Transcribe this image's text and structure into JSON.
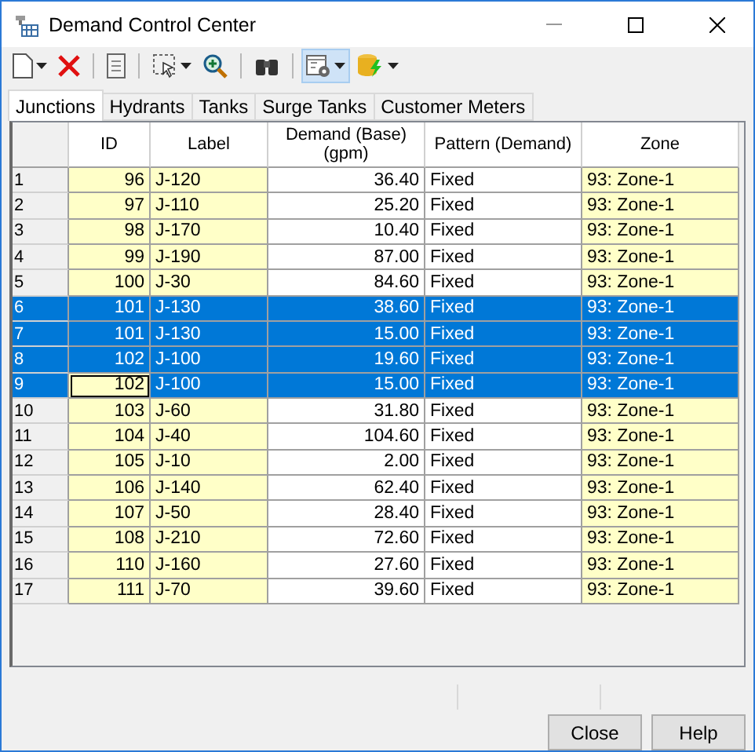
{
  "window": {
    "title": "Demand Control Center"
  },
  "toolbar": [
    {
      "kind": "new",
      "dropdown": true,
      "highlighted": false
    },
    {
      "kind": "delete",
      "dropdown": false,
      "highlighted": false
    },
    {
      "kind": "separator"
    },
    {
      "kind": "report",
      "dropdown": false,
      "highlighted": false
    },
    {
      "kind": "separator"
    },
    {
      "kind": "select",
      "dropdown": true,
      "highlighted": false
    },
    {
      "kind": "zoom",
      "dropdown": false,
      "highlighted": false
    },
    {
      "kind": "separator"
    },
    {
      "kind": "find",
      "dropdown": false,
      "highlighted": false
    },
    {
      "kind": "separator"
    },
    {
      "kind": "options",
      "dropdown": true,
      "highlighted": true
    },
    {
      "kind": "database",
      "dropdown": true,
      "highlighted": false
    }
  ],
  "tabs": [
    {
      "label": "Junctions",
      "selected": true
    },
    {
      "label": "Hydrants",
      "selected": false
    },
    {
      "label": "Tanks",
      "selected": false
    },
    {
      "label": "Surge Tanks",
      "selected": false
    },
    {
      "label": "Customer Meters",
      "selected": false
    }
  ],
  "table": {
    "columns": [
      {
        "label": "ID",
        "editable": false,
        "kind": "number"
      },
      {
        "label": "Label",
        "editable": false,
        "kind": "text"
      },
      {
        "label": "Demand (Base)\n(gpm)",
        "editable": true,
        "kind": "number"
      },
      {
        "label": "Pattern (Demand)",
        "editable": true,
        "kind": "text"
      },
      {
        "label": "Zone",
        "editable": false,
        "kind": "text"
      }
    ],
    "rows": [
      {
        "header": "1",
        "selected": false,
        "cells": [
          "96",
          "J-120",
          "36.40",
          "Fixed",
          "93: Zone-1"
        ]
      },
      {
        "header": "2",
        "selected": false,
        "cells": [
          "97",
          "J-110",
          "25.20",
          "Fixed",
          "93: Zone-1"
        ]
      },
      {
        "header": "3",
        "selected": false,
        "cells": [
          "98",
          "J-170",
          "10.40",
          "Fixed",
          "93: Zone-1"
        ]
      },
      {
        "header": "4",
        "selected": false,
        "cells": [
          "99",
          "J-190",
          "87.00",
          "Fixed",
          "93: Zone-1"
        ]
      },
      {
        "header": "5",
        "selected": false,
        "cells": [
          "100",
          "J-30",
          "84.60",
          "Fixed",
          "93: Zone-1"
        ]
      },
      {
        "header": "6",
        "selected": true,
        "cells": [
          "101",
          "J-130",
          "38.60",
          "Fixed",
          "93: Zone-1"
        ]
      },
      {
        "header": "7",
        "selected": true,
        "cells": [
          "101",
          "J-130",
          "15.00",
          "Fixed",
          "93: Zone-1"
        ]
      },
      {
        "header": "8",
        "selected": true,
        "cells": [
          "102",
          "J-100",
          "19.60",
          "Fixed",
          "93: Zone-1"
        ]
      },
      {
        "header": "9",
        "selected": true,
        "current": true,
        "cells": [
          "102",
          "J-100",
          "15.00",
          "Fixed",
          "93: Zone-1"
        ]
      },
      {
        "header": "10",
        "selected": false,
        "cells": [
          "103",
          "J-60",
          "31.80",
          "Fixed",
          "93: Zone-1"
        ]
      },
      {
        "header": "11",
        "selected": false,
        "cells": [
          "104",
          "J-40",
          "104.60",
          "Fixed",
          "93: Zone-1"
        ]
      },
      {
        "header": "12",
        "selected": false,
        "cells": [
          "105",
          "J-10",
          "2.00",
          "Fixed",
          "93: Zone-1"
        ]
      },
      {
        "header": "13",
        "selected": false,
        "cells": [
          "106",
          "J-140",
          "62.40",
          "Fixed",
          "93: Zone-1"
        ]
      },
      {
        "header": "14",
        "selected": false,
        "cells": [
          "107",
          "J-50",
          "28.40",
          "Fixed",
          "93: Zone-1"
        ]
      },
      {
        "header": "15",
        "selected": false,
        "cells": [
          "108",
          "J-210",
          "72.60",
          "Fixed",
          "93: Zone-1"
        ]
      },
      {
        "header": "16",
        "selected": false,
        "cells": [
          "110",
          "J-160",
          "27.60",
          "Fixed",
          "93: Zone-1"
        ]
      },
      {
        "header": "17",
        "selected": false,
        "cells": [
          "111",
          "J-70",
          "39.60",
          "Fixed",
          "93: Zone-1"
        ]
      }
    ]
  },
  "buttons": [
    "Close",
    "Help"
  ]
}
